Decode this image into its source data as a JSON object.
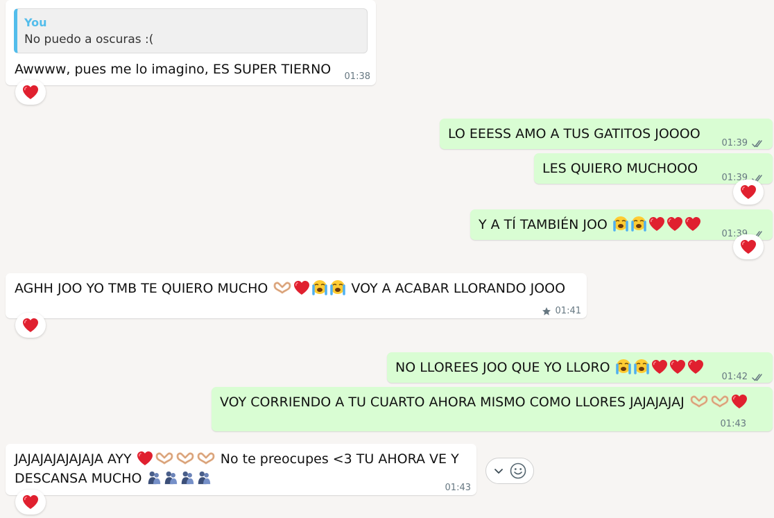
{
  "colors": {
    "background": "#f7f5f3",
    "incoming_bubble": "#ffffff",
    "outgoing_bubble": "#d9fdd3",
    "quote_accent": "#53bdeb",
    "heart": "#e0202f"
  },
  "messages": [
    {
      "direction": "in",
      "quote": {
        "author": "You",
        "text": "No puedo a oscuras :("
      },
      "text": "Awwww, pues me lo imagino, ES SUPER TIERNO",
      "time": "01:38",
      "reaction": "red-heart"
    },
    {
      "direction": "out",
      "text": "LO EEESS AMO A TUS GATITOS JOOOO",
      "time": "01:39",
      "status": "read-ticks"
    },
    {
      "direction": "out",
      "text": "LES QUIERO MUCHOOO",
      "time": "01:39",
      "status": "read-ticks",
      "reaction": "red-heart"
    },
    {
      "direction": "out",
      "text": "Y A TÍ TAMBIÉN JOO",
      "emojis": [
        "loudly-crying",
        "loudly-crying",
        "red-heart",
        "red-heart",
        "red-heart"
      ],
      "time": "01:39",
      "status": "read-ticks",
      "reaction": "red-heart"
    },
    {
      "direction": "in",
      "text_before": "AGHH JOO YO TMB TE QUIERO MUCHO",
      "emojis": [
        "heart-hands",
        "red-heart",
        "loudly-crying",
        "loudly-crying"
      ],
      "text_after": "VOY A ACABAR LLORANDO JOOO",
      "time": "01:41",
      "starred": true,
      "reaction": "red-heart"
    },
    {
      "direction": "out",
      "text": "NO LLOREES JOO QUE YO LLORO",
      "emojis": [
        "loudly-crying",
        "loudly-crying",
        "red-heart",
        "red-heart",
        "red-heart"
      ],
      "time": "01:42",
      "status": "read-ticks"
    },
    {
      "direction": "out",
      "text": "VOY CORRIENDO A TU CUARTO AHORA MISMO COMO LLORES JAJAJAJAJ",
      "emojis": [
        "heart-hands",
        "heart-hands",
        "red-heart"
      ],
      "time": "01:43"
    },
    {
      "direction": "in",
      "text_line1_before": "JAJAJAJAJAJAJA AYY",
      "emojis_line1": [
        "red-heart",
        "heart-hands",
        "heart-hands",
        "heart-hands"
      ],
      "text_line1_after": "No te preocupes <3 TU AHORA VE Y",
      "text_line2": "DESCANSA MUCHO",
      "emojis_line2": [
        "people-hugging",
        "people-hugging",
        "people-hugging",
        "people-hugging"
      ],
      "time": "01:43",
      "reaction": "red-heart"
    }
  ],
  "hover_actions": {
    "icons": [
      "chevron-down-icon",
      "emoji-smile-icon"
    ]
  }
}
